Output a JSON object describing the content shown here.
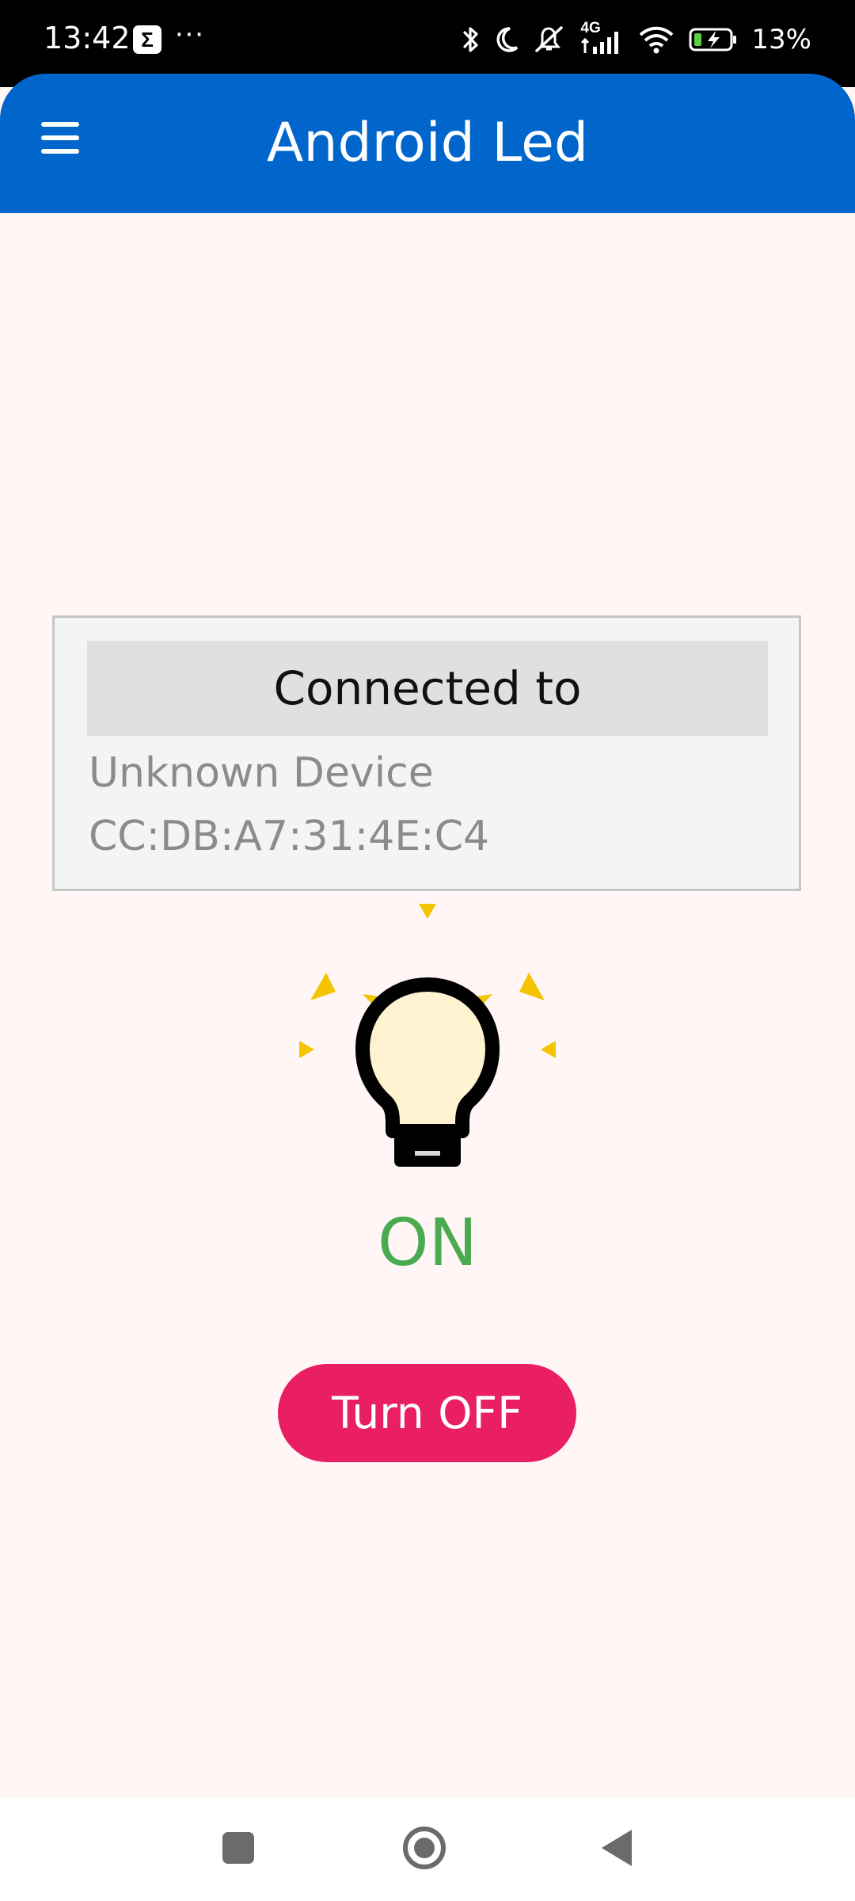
{
  "status_bar": {
    "time": "13:42",
    "notification_icon": "sigma-notification-icon",
    "more_notifications": "···",
    "icons": [
      "bluetooth-icon",
      "moon-icon",
      "muted-bell-icon",
      "signal-4g-icon",
      "wifi-icon",
      "battery-charging-icon"
    ],
    "network_label": "4G",
    "battery": "13%"
  },
  "app_bar": {
    "title": "Android Led",
    "menu_icon": "hamburger-menu-icon"
  },
  "connection": {
    "header": "Connected to",
    "device_name": "Unknown Device",
    "device_address": "CC:DB:A7:31:4E:C4"
  },
  "led": {
    "icon": "lightbulb-on-icon",
    "state": "ON",
    "button_label": "Turn OFF",
    "colors": {
      "state_text": "#4aaa50",
      "button": "#e91e63",
      "bulb_glass": "#fff2d0",
      "rays": "#f5c400"
    }
  },
  "colors": {
    "app_bar": "#0066cc",
    "background": "#fff6f5"
  },
  "nav_bar": {
    "buttons": [
      "recent-apps-icon",
      "home-icon",
      "back-icon"
    ]
  }
}
